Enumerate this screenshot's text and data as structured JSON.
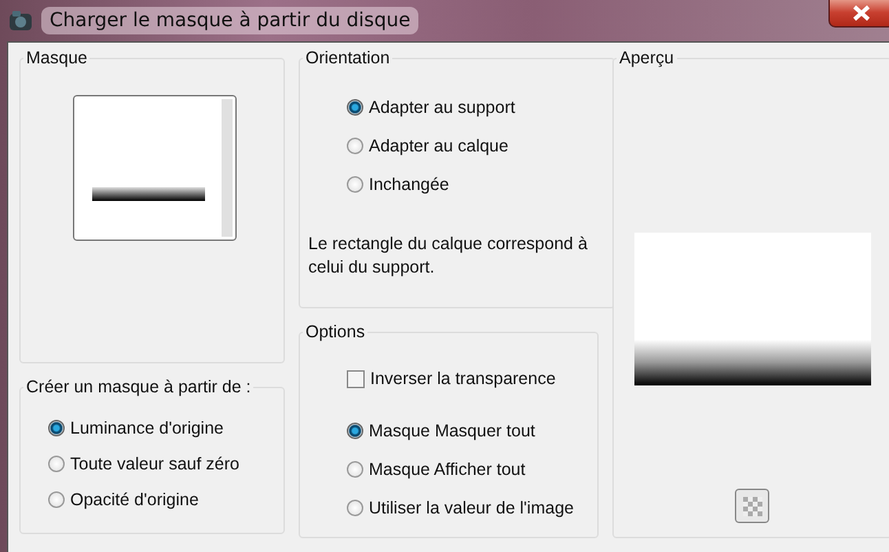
{
  "window": {
    "title": "Charger le masque à partir du disque"
  },
  "mask": {
    "legend": "Masque"
  },
  "create_from": {
    "legend": "Créer un masque à partir de :",
    "choices": [
      {
        "label": "Luminance d'origine",
        "selected": true
      },
      {
        "label": "Toute valeur sauf zéro",
        "selected": false
      },
      {
        "label": "Opacité d'origine",
        "selected": false
      }
    ]
  },
  "orientation": {
    "legend": "Orientation",
    "choices": [
      {
        "label": "Adapter au support",
        "selected": true
      },
      {
        "label": "Adapter au calque",
        "selected": false
      },
      {
        "label": "Inchangée",
        "selected": false
      }
    ],
    "description": "Le rectangle du calque correspond à celui du support."
  },
  "options": {
    "legend": "Options",
    "invert": {
      "label": "Inverser la transparence",
      "checked": false
    },
    "choices": [
      {
        "label": "Masque Masquer tout",
        "selected": true
      },
      {
        "label": "Masque Afficher tout",
        "selected": false
      },
      {
        "label": "Utiliser la valeur de l'image",
        "selected": false
      }
    ]
  },
  "preview": {
    "legend": "Aperçu"
  }
}
